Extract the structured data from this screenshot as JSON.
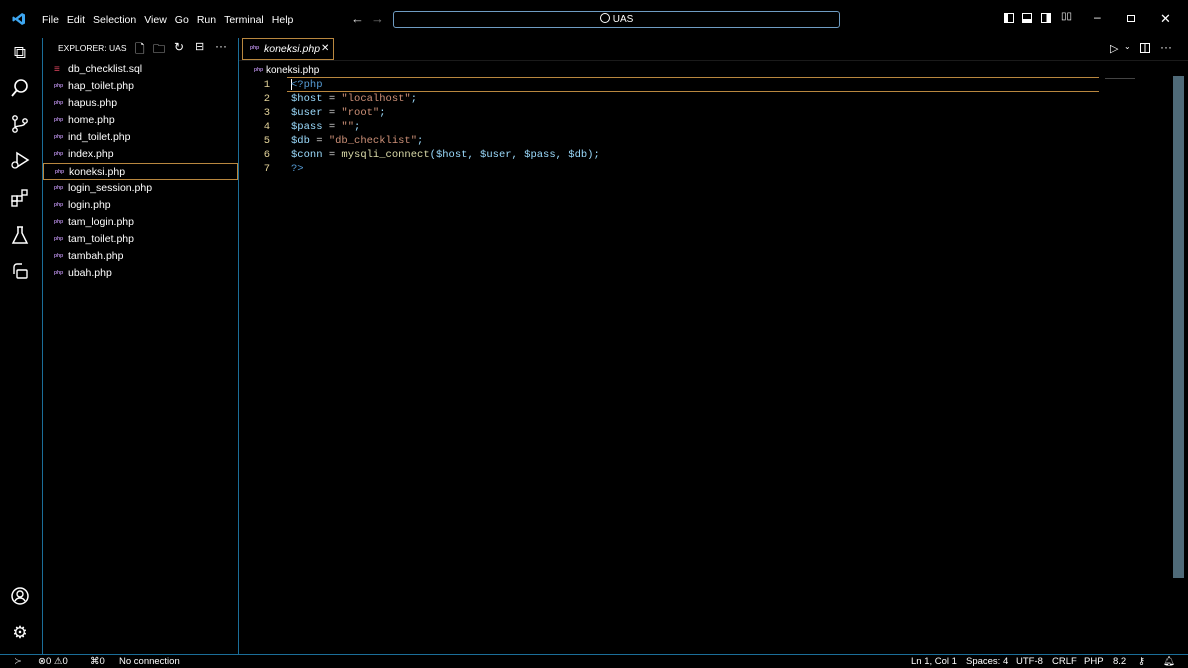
{
  "menu": [
    "File",
    "Edit",
    "Selection",
    "View",
    "Go",
    "Run",
    "Terminal",
    "Help"
  ],
  "search": {
    "label": "UAS"
  },
  "explorer": {
    "title": "EXPLORER: UAS",
    "files": [
      {
        "name": "db_checklist.sql",
        "type": "sql"
      },
      {
        "name": "hap_toilet.php",
        "type": "php"
      },
      {
        "name": "hapus.php",
        "type": "php"
      },
      {
        "name": "home.php",
        "type": "php"
      },
      {
        "name": "ind_toilet.php",
        "type": "php"
      },
      {
        "name": "index.php",
        "type": "php"
      },
      {
        "name": "koneksi.php",
        "type": "php",
        "selected": true
      },
      {
        "name": "login_session.php",
        "type": "php"
      },
      {
        "name": "login.php",
        "type": "php"
      },
      {
        "name": "tam_login.php",
        "type": "php"
      },
      {
        "name": "tam_toilet.php",
        "type": "php"
      },
      {
        "name": "tambah.php",
        "type": "php"
      },
      {
        "name": "ubah.php",
        "type": "php"
      }
    ]
  },
  "editor": {
    "tab_label": "koneksi.php",
    "breadcrumb": "koneksi.php",
    "lines": [
      {
        "n": "1",
        "text": "<?php"
      },
      {
        "n": "2",
        "text": "$host = \"localhost\";"
      },
      {
        "n": "3",
        "text": "$user = \"root\";"
      },
      {
        "n": "4",
        "text": "$pass = \"\";"
      },
      {
        "n": "5",
        "text": "$db = \"db_checklist\";"
      },
      {
        "n": "6",
        "text": "$conn = mysqli_connect($host, $user, $pass, $db);"
      },
      {
        "n": "7",
        "text": "?>"
      }
    ]
  },
  "status": {
    "errors": "0",
    "warnings": "0",
    "ports": "0",
    "connection": "No connection",
    "position": "Ln 1, Col 1",
    "spaces": "Spaces: 4",
    "encoding": "UTF-8",
    "eol": "CRLF",
    "language": "PHP",
    "version": "8.2"
  },
  "colors": {
    "accent": "#1b6e99",
    "selection": "#b9873f",
    "php_icon": "#a17cc8"
  }
}
